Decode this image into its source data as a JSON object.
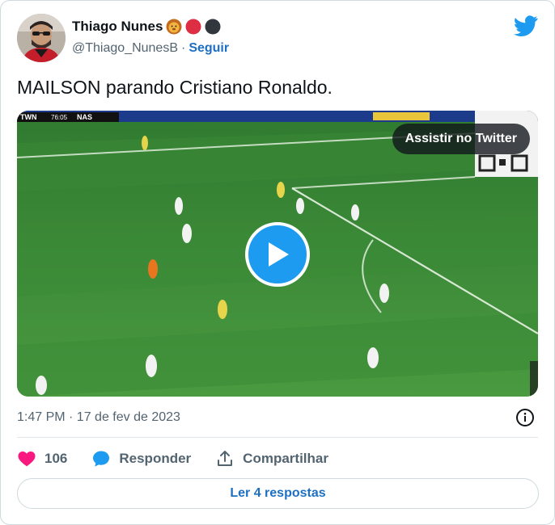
{
  "author": {
    "display_name": "Thiago Nunes",
    "handle": "@Thiago_NunesB",
    "separator": "·",
    "follow_label": "Seguir"
  },
  "tweet": {
    "text": "MAILSON parando Cristiano Ronaldo.",
    "timestamp": "1:47 PM · 17 de fev de 2023"
  },
  "video": {
    "watch_label": "Assistir no Twitter",
    "scoreboard_left": "TWN",
    "scoreboard_time": "76:05",
    "scoreboard_right": "NAS"
  },
  "actions": {
    "like_count": "106",
    "reply_label": "Responder",
    "share_label": "Compartilhar"
  },
  "replies_button": "Ler 4 respostas",
  "colors": {
    "twitter_blue": "#1d9bf0",
    "like_pink": "#f91880",
    "link_blue": "#1d6fc4",
    "muted_text": "#536471"
  }
}
